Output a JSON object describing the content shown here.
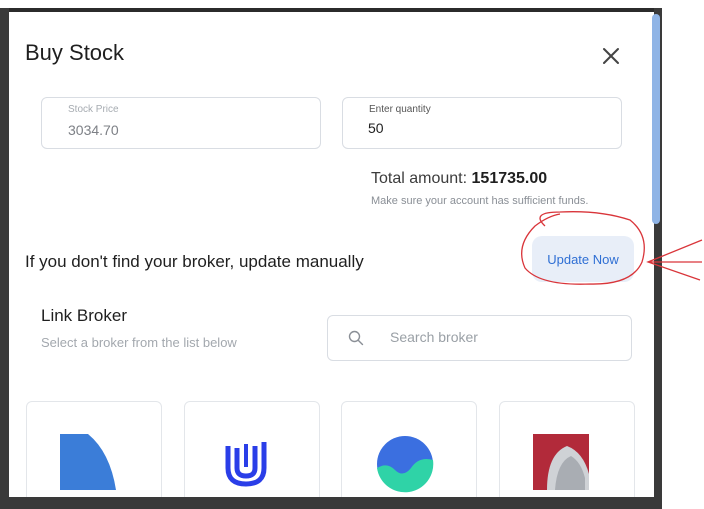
{
  "dialog": {
    "title": "Buy Stock",
    "close_icon": "close-icon"
  },
  "stock_price": {
    "label": "Stock Price",
    "value": "3034.70"
  },
  "quantity": {
    "label": "Enter quantity",
    "value": "50"
  },
  "total": {
    "label": "Total amount:",
    "amount": "151735.00",
    "note": "Make sure your account has sufficient funds."
  },
  "manual": {
    "text": "If you don't find your broker, update manually",
    "button_label": "Update Now"
  },
  "link_broker": {
    "title": "Link Broker",
    "subtitle": "Select a broker from the list below",
    "search_placeholder": "Search broker",
    "search_icon": "search-icon"
  },
  "brokers": [
    {
      "logo": "blue-quarter-logo",
      "color": "#3b7dd8"
    },
    {
      "logo": "u-stripes-logo",
      "color": "#2a3ee8"
    },
    {
      "logo": "green-wave-circle-logo",
      "color": "#2fd3a7"
    },
    {
      "logo": "red-metal-logo",
      "color": "#b22a3a"
    }
  ],
  "colors": {
    "accent": "#2f6fd4",
    "button_bg": "#e8eef8",
    "annotation": "#d9353a"
  }
}
